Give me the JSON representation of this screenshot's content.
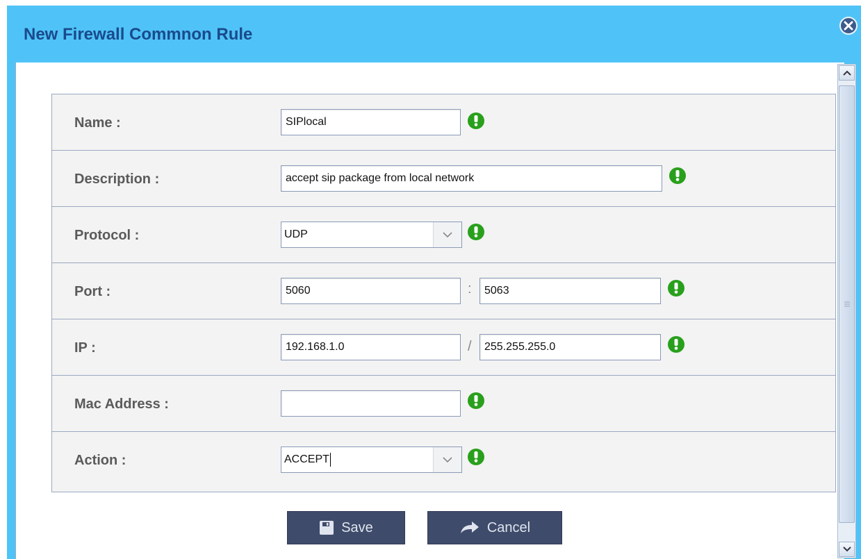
{
  "dialog": {
    "title": "New Firewall Commnon Rule"
  },
  "form": {
    "name": {
      "label": "Name :",
      "value": "SIPlocal"
    },
    "description": {
      "label": "Description :",
      "value": "accept sip package from local network"
    },
    "protocol": {
      "label": "Protocol :",
      "selected": "UDP"
    },
    "port": {
      "label": "Port :",
      "start": "5060",
      "separator": ":",
      "end": "5063"
    },
    "ip": {
      "label": "IP :",
      "address": "192.168.1.0",
      "separator": "/",
      "mask": "255.255.255.0"
    },
    "mac": {
      "label": "Mac Address :",
      "value": ""
    },
    "action": {
      "label": "Action :",
      "selected": "ACCEPT"
    }
  },
  "buttons": {
    "save_label": "Save",
    "cancel_label": "Cancel"
  },
  "icons": {
    "validation": "exclamation-circle-icon",
    "close": "close-icon",
    "save": "floppy-disk-icon",
    "cancel": "forward-arrow-icon"
  },
  "colors": {
    "titlebar": "#4fc3f7",
    "title_text": "#1a4a8c",
    "valid_icon": "#29a01c",
    "button_bg": "#3f4b6b"
  }
}
